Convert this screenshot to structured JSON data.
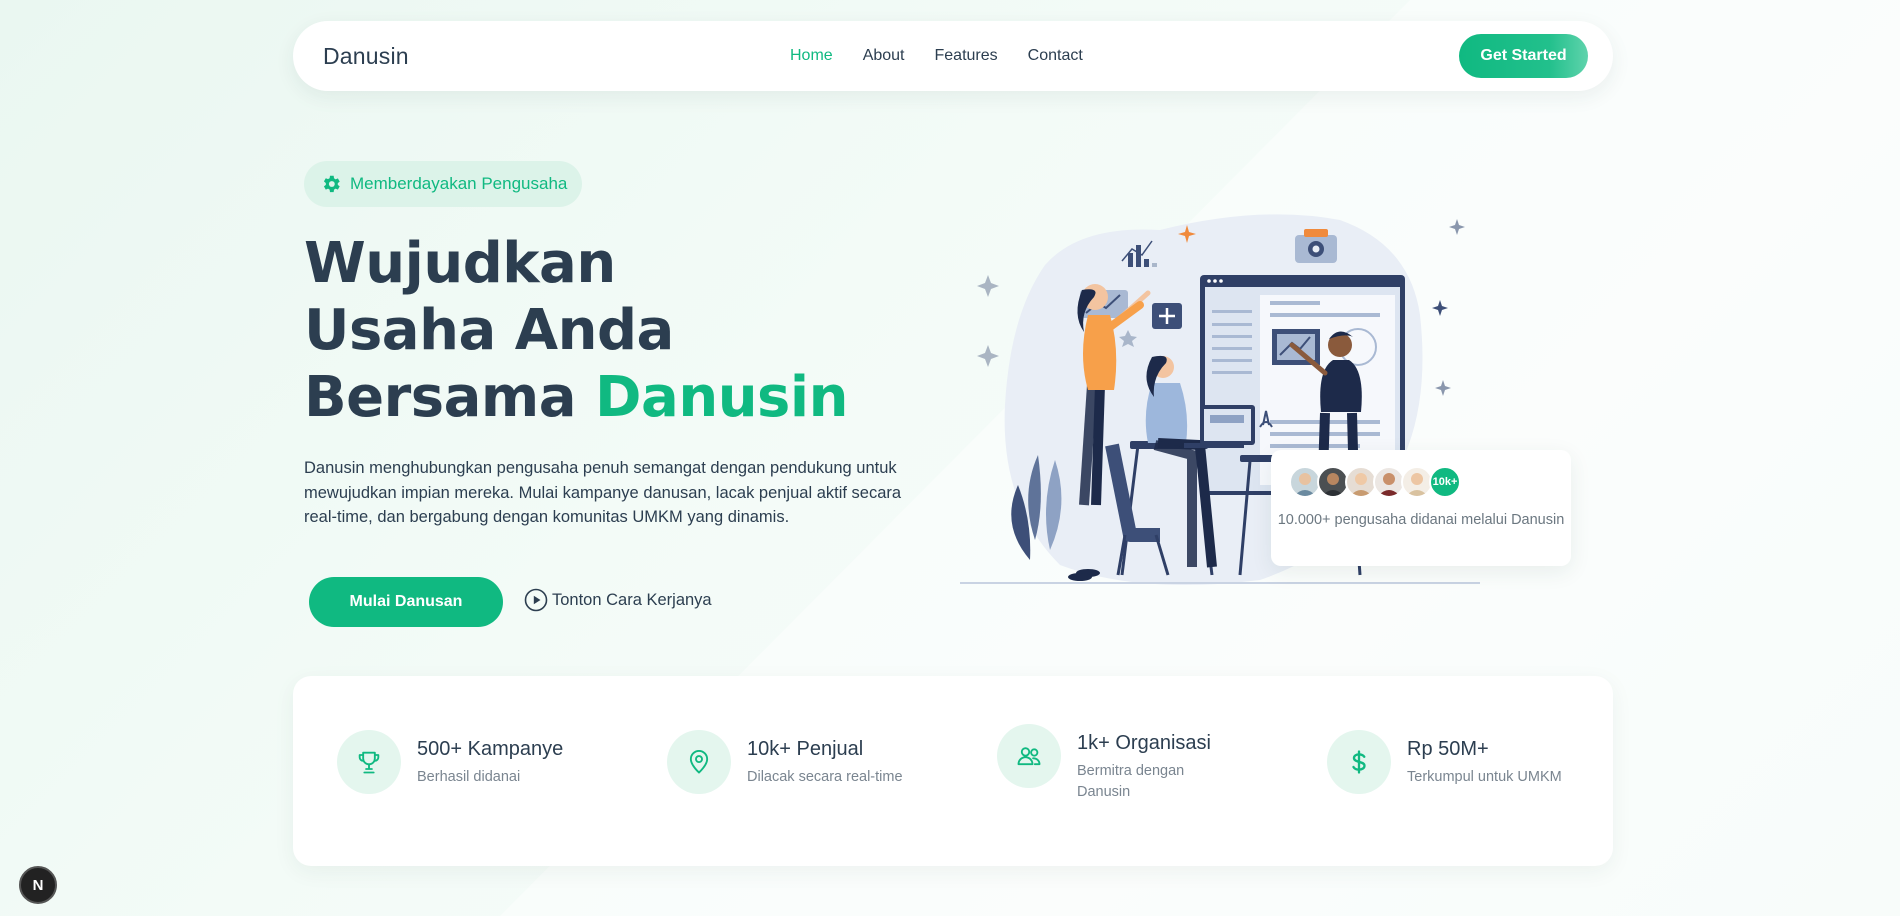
{
  "nav": {
    "brand": "Danusin",
    "links": [
      "Home",
      "About",
      "Features",
      "Contact"
    ],
    "active": "Home",
    "cta": "Get Started"
  },
  "hero": {
    "badge": "Memberdayakan Pengusaha",
    "title_line1": "Wujudkan",
    "title_line2": "Usaha Anda",
    "title_line3_prefix": "Bersama ",
    "title_line3_accent": "Danusin",
    "description": "Danusin menghubungkan pengusaha penuh semangat dengan pendukung untuk mewujudkan impian mereka. Mulai kampanye danusan, lacak penjual aktif secara real-time, dan bergabung dengan komunitas UMKM yang dinamis.",
    "primary_button": "Mulai Danusan",
    "video_button": "Tonton Cara Kerjanya"
  },
  "fund_card": {
    "count_badge": "10k+",
    "text": "10.000+ pengusaha didanai melalui Danusin"
  },
  "stats": [
    {
      "icon": "trophy-icon",
      "value": "500+ Kampanye",
      "label": "Berhasil didanai"
    },
    {
      "icon": "map-pin-icon",
      "value": "10k+ Penjual",
      "label": "Dilacak secara real-time"
    },
    {
      "icon": "users-icon",
      "value": "1k+ Organisasi",
      "label": "Bermitra dengan Danusin"
    },
    {
      "icon": "dollar-icon",
      "value": "Rp 50M+",
      "label": "Terkumpul untuk UMKM"
    }
  ],
  "dev_badge": "N",
  "colors": {
    "accent": "#10b981",
    "text": "#2c3e50",
    "muted": "#7a8590"
  }
}
